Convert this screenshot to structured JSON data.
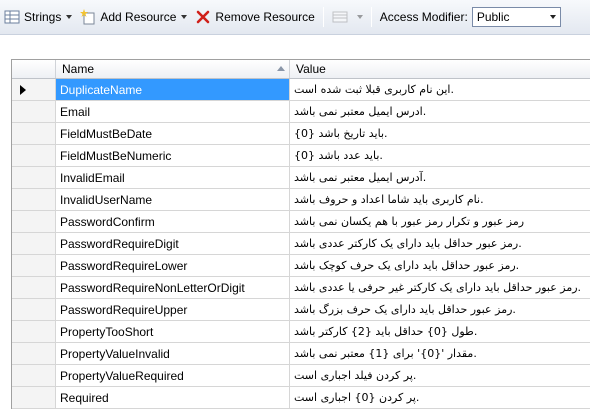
{
  "toolbar": {
    "strings_label": "Strings",
    "add_resource_label": "Add Resource",
    "remove_resource_label": "Remove Resource",
    "access_modifier_label": "Access Modifier:",
    "access_modifier_value": "Public"
  },
  "grid": {
    "columns": {
      "name": "Name",
      "value": "Value"
    },
    "rows": [
      {
        "name": "DuplicateName",
        "value": "این نام کاربری قبلا ثبت شده است."
      },
      {
        "name": "Email",
        "value": "ادرس ایمیل معتبر نمی باشد."
      },
      {
        "name": "FieldMustBeDate",
        "value": "{0} باید تاریخ باشد."
      },
      {
        "name": "FieldMustBeNumeric",
        "value": "{0} باید عدد باشد."
      },
      {
        "name": "InvalidEmail",
        "value": "آدرس ایمیل معتبر نمی باشد."
      },
      {
        "name": "InvalidUserName",
        "value": "نام کاربری باید شاما اعداد و حروف باشد."
      },
      {
        "name": "PasswordConfirm",
        "value": "رمز عبور و تکرار رمز عبور با هم یکسان نمی باشد"
      },
      {
        "name": "PasswordRequireDigit",
        "value": "رمز عبور حداقل باید دارای یک کارکتر عددی باشد."
      },
      {
        "name": "PasswordRequireLower",
        "value": "رمز عبور حداقل باید دارای یک حرف کوچک باشد."
      },
      {
        "name": "PasswordRequireNonLetterOrDigit",
        "value": "رمز عبور حداقل باید دارای یک کارکتر غیر حرفی یا عددی باشد."
      },
      {
        "name": "PasswordRequireUpper",
        "value": "رمز عبور حداقل باید دارای یک حرف بزرگ باشد."
      },
      {
        "name": "PropertyTooShort",
        "value": "طول {0} حداقل باید {2} کارکتر باشد."
      },
      {
        "name": "PropertyValueInvalid",
        "value": "مقدار '{0}' برای {1} معتبر نمی باشد."
      },
      {
        "name": "PropertyValueRequired",
        "value": "پر کردن فیلد اجباری است."
      },
      {
        "name": "Required",
        "value": "پر کردن {0} اجباری است."
      }
    ]
  }
}
